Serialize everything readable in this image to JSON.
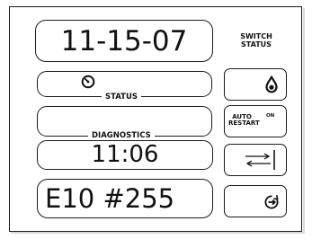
{
  "display": {
    "date": "11-15-07",
    "status_label": "STATUS",
    "diagnostics_label": "DIAGNOSTICS",
    "time": "11:06",
    "error_code": "E10 #255"
  },
  "switch_panel": {
    "header_line1": "SWITCH",
    "header_line2": "STATUS",
    "auto_restart_line1": "AUTO",
    "auto_restart_line2": "RESTART",
    "auto_restart_state": "ON"
  },
  "icons": {
    "status": "gauge-icon",
    "fuel": "fuel-drop-icon",
    "transfer": "transfer-arrows-icon",
    "restart": "restart-icon"
  }
}
